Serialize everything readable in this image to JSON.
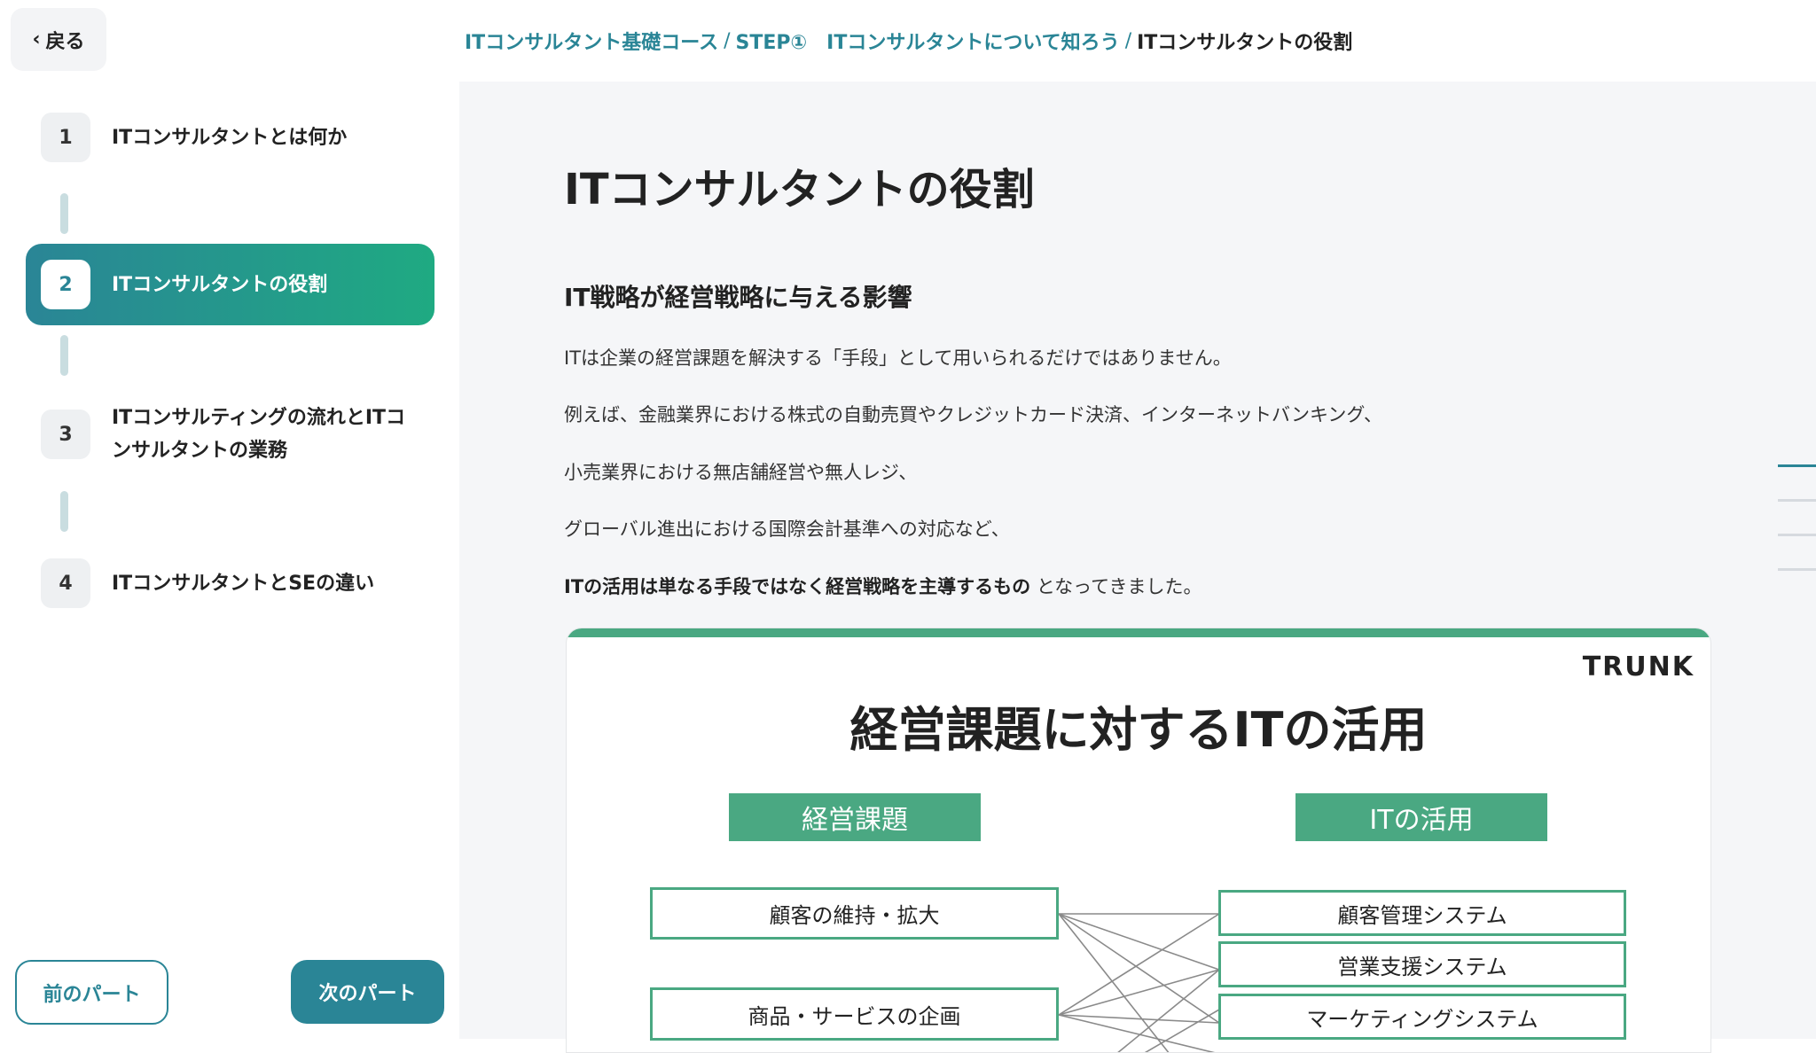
{
  "header": {
    "back_label": "戻る",
    "breadcrumb": {
      "course": "ITコンサルタント基礎コース",
      "step": "STEP①　ITコンサルタントについて知ろう",
      "current": "ITコンサルタントの役割",
      "separator": "/"
    }
  },
  "sidebar": {
    "steps": [
      {
        "num": "1",
        "label": "ITコンサルタントとは何か"
      },
      {
        "num": "2",
        "label": "ITコンサルタントの役割"
      },
      {
        "num": "3",
        "label": "ITコンサルティングの流れとITコンサルタントの業務"
      },
      {
        "num": "4",
        "label": "ITコンサルタントとSEの違い"
      }
    ],
    "active_step": 2,
    "prev_label": "前のパート",
    "next_label": "次のパート"
  },
  "main": {
    "title": "ITコンサルタントの役割",
    "section_title": "IT戦略が経営戦略に与える影響",
    "paragraphs": {
      "p1": "ITは企業の経営課題を解決する「手段」として用いられるだけではありません。",
      "p2": "例えば、金融業界における株式の自動売買やクレジットカード決済、インターネットバンキング、",
      "p3": "小売業界における無店舗経営や無人レジ、",
      "p4": "グローバル進出における国際会計基準への対応など、",
      "p5_bold": "ITの活用は単なる手段ではなく経営戦略を主導するもの",
      "p5_rest": " となってきました。"
    },
    "figure": {
      "brand": "TRUNK",
      "title": "経営課題に対するITの活用",
      "left_header": "経営課題",
      "right_header": "ITの活用",
      "left_items": [
        "顧客の維持・拡大",
        "商品・サービスの企画"
      ],
      "right_items": [
        "顧客管理システム",
        "営業支援システム",
        "マーケティングシステム"
      ]
    }
  },
  "colors": {
    "accent": "#2a8596",
    "accent_green": "#1faa82",
    "figure_green": "#4aa882",
    "main_bg": "#f5f6f8"
  }
}
